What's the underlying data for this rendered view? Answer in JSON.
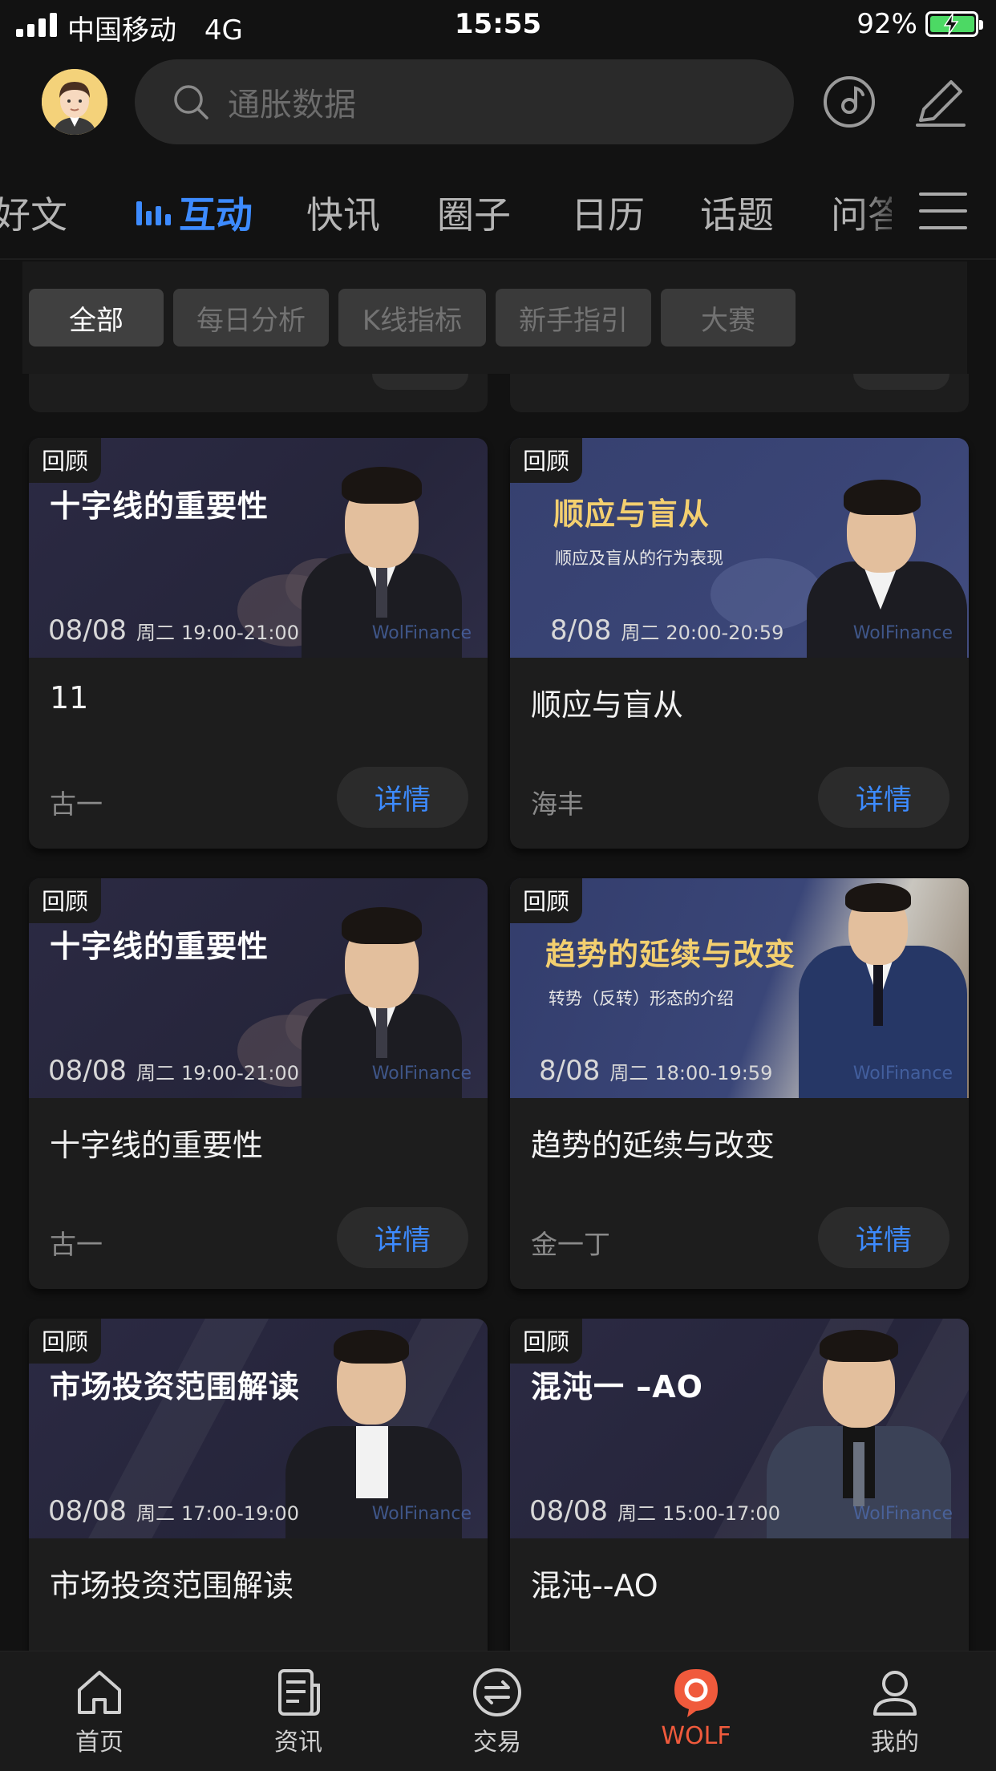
{
  "status_bar": {
    "carrier": "中国移动",
    "network": "4G",
    "time": "15:55",
    "battery": "92%",
    "battery_level": 0.92
  },
  "header": {
    "search_placeholder": "通胀数据",
    "avatar_icon": "avatar-icon",
    "music_icon": "music-disc-icon",
    "edit_icon": "pencil-icon"
  },
  "tabs": [
    {
      "label": "好文",
      "active": false
    },
    {
      "label": "互动",
      "active": true
    },
    {
      "label": "快讯",
      "active": false
    },
    {
      "label": "圈子",
      "active": false
    },
    {
      "label": "日历",
      "active": false
    },
    {
      "label": "话题",
      "active": false
    },
    {
      "label": "问答",
      "active": false
    }
  ],
  "filters": [
    "全部",
    "每日分析",
    "K线指标",
    "新手指引",
    "大赛"
  ],
  "cards": [
    {
      "badge": "回顾",
      "thumb_title": "十字线的重要性",
      "thumb_sub": "",
      "date": "08/08",
      "weekday": "周二",
      "time": "19:00-21:00",
      "watermark": "WolFinance",
      "title": "11",
      "author": "古一",
      "button": "详情"
    },
    {
      "badge": "回顾",
      "thumb_title": "顺应与盲从",
      "thumb_sub": "顺应及盲从的行为表现",
      "date": "8/08",
      "weekday": "周二",
      "time": "20:00-20:59",
      "watermark": "WolFinance",
      "title": "顺应与盲从",
      "author": "海丰",
      "button": "详情"
    },
    {
      "badge": "回顾",
      "thumb_title": "十字线的重要性",
      "thumb_sub": "",
      "date": "08/08",
      "weekday": "周二",
      "time": "19:00-21:00",
      "watermark": "WolFinance",
      "title": "十字线的重要性",
      "author": "古一",
      "button": "详情"
    },
    {
      "badge": "回顾",
      "thumb_title": "趋势的延续与改变",
      "thumb_sub": "转势（反转）形态的介绍",
      "date": "8/08",
      "weekday": "周二",
      "time": "18:00-19:59",
      "watermark": "WolFinance",
      "title": "趋势的延续与改变",
      "author": "金一丁",
      "button": "详情"
    },
    {
      "badge": "回顾",
      "thumb_title": "市场投资范围解读",
      "thumb_sub": "",
      "date": "08/08",
      "weekday": "周二",
      "time": "17:00-19:00",
      "watermark": "WolFinance",
      "title": "市场投资范围解读",
      "author": "",
      "button": ""
    },
    {
      "badge": "回顾",
      "thumb_title": "混沌一 –AO",
      "thumb_sub": "",
      "date": "08/08",
      "weekday": "周二",
      "time": "15:00-17:00",
      "watermark": "WolFinance",
      "title": "混沌--AO",
      "author": "",
      "button": ""
    }
  ],
  "bottom_nav": [
    {
      "label": "首页",
      "icon": "home-icon",
      "active": false
    },
    {
      "label": "资讯",
      "icon": "news-icon",
      "active": false
    },
    {
      "label": "交易",
      "icon": "exchange-icon",
      "active": false
    },
    {
      "label": "WOLF",
      "icon": "wolf-icon",
      "active": true
    },
    {
      "label": "我的",
      "icon": "profile-icon",
      "active": false
    }
  ],
  "colors": {
    "accent": "#3d8bff",
    "wolf_active": "#f05a3c",
    "background": "#121212",
    "card": "#1d1d1d",
    "gold_title": "#f3cf6f"
  }
}
